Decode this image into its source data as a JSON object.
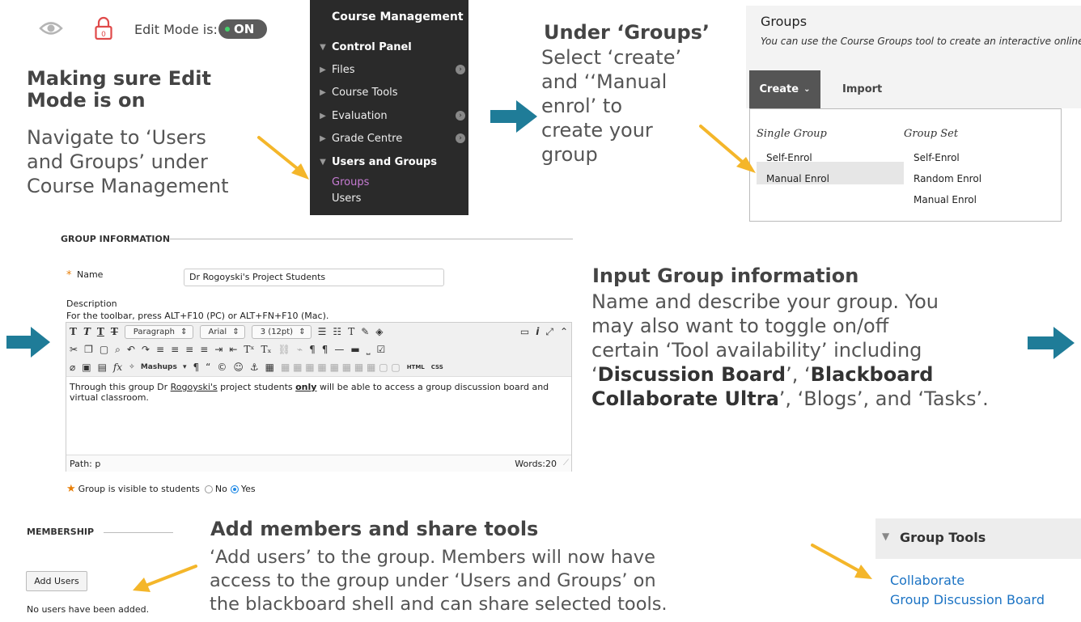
{
  "colors": {
    "yellow_arrow": "#F4B62A",
    "blue_arrow": "#1F7C98",
    "toggle_bg": "#5B5B5B",
    "toggle_dot": "#44D16B"
  },
  "section_edit_mode": {
    "edit_mode_label": "Edit Mode is:",
    "toggle_label": "ON",
    "heading": [
      "Making sure Edit",
      "Mode is on"
    ],
    "body": [
      "Navigate to ‘Users",
      "and Groups’ under",
      "Course Management"
    ]
  },
  "course_management": {
    "title": "Course Management",
    "items": [
      {
        "label": "Control Panel",
        "open": true,
        "bold": true
      },
      {
        "label": "Files",
        "open": false,
        "has_circle": true
      },
      {
        "label": "Course Tools",
        "open": false
      },
      {
        "label": "Evaluation",
        "open": false,
        "has_circle": true
      },
      {
        "label": "Grade Centre",
        "open": false,
        "has_circle": true
      },
      {
        "label": "Users and Groups",
        "open": true,
        "bold": true
      }
    ],
    "sub_items": [
      {
        "label": "Groups",
        "color": "#C77CD4"
      },
      {
        "label": "Users",
        "color": "#EEEEEE"
      }
    ]
  },
  "section_groups": {
    "heading": "Under ‘Groups’",
    "body": [
      "Select ‘create’",
      "and ‘‘Manual",
      "enrol’ to",
      "create your",
      "group"
    ]
  },
  "groups_panel": {
    "title": "Groups",
    "description": "You can use the Course Groups tool to create an interactive online en",
    "create_label": "Create",
    "import_label": "Import",
    "single_group_heading": "Single Group",
    "group_set_heading": "Group Set",
    "single_group_items": [
      "Self-Enrol",
      "Manual Enrol"
    ],
    "group_set_items": [
      "Self-Enrol",
      "Random Enrol",
      "Manual Enrol"
    ]
  },
  "group_information": {
    "section_label": "GROUP INFORMATION",
    "name_label": "Name",
    "name_value": "Dr Rogoyski's Project Students",
    "description_label": "Description",
    "toolbar_hint": "For the toolbar, press ALT+F10 (PC) or ALT+FN+F10 (Mac).",
    "paragraph_select": "Paragraph",
    "font_select": "Arial",
    "size_select": "3 (12pt)",
    "mashups_label": "Mashups",
    "html_label": "HTML",
    "css_label": "CSS",
    "editor_text_before": "Through this group Dr ",
    "editor_text_name": "Rogoyski's",
    "editor_text_mid": " project students ",
    "editor_text_only": "only",
    "editor_text_after": " will be able to access a group discussion board and virtual classroom.",
    "path_label": "Path: p",
    "words_label": "Words:20",
    "visible_label": "Group is visible to students",
    "no_label": "No",
    "yes_label": "Yes"
  },
  "section_input": {
    "heading": "Input Group information",
    "body_l1": "Name and describe your group. You",
    "body_l2": "may also want to toggle on/off",
    "body_l3": "certain ‘Tool availability’ including",
    "body_l4_a": "‘",
    "body_l4_b1": "Discussion Board",
    "body_l4_c": "’, ‘",
    "body_l4_b2": "Blackboard",
    "body_l5_b": "Collaborate Ultra",
    "body_l5_c": "’, ‘Blogs’, and ‘Tasks’."
  },
  "membership": {
    "section_label": "MEMBERSHIP",
    "add_users_label": "Add Users",
    "no_users_text": "No users have been added."
  },
  "section_members": {
    "heading": "Add members and share tools",
    "body": [
      "‘Add users’ to the group. Members will now have",
      "access to the group under ‘Users and Groups’ on",
      "the blackboard shell and can share selected tools."
    ]
  },
  "group_tools": {
    "title": "Group Tools",
    "links": [
      "Collaborate",
      "Group Discussion Board"
    ]
  },
  "icons": [
    "eye-slash-icon",
    "lock-icon",
    "triangle-down-icon",
    "triangle-right-icon",
    "circle-arrow-icon",
    "arrow-right-icon",
    "chevron-down-icon"
  ]
}
